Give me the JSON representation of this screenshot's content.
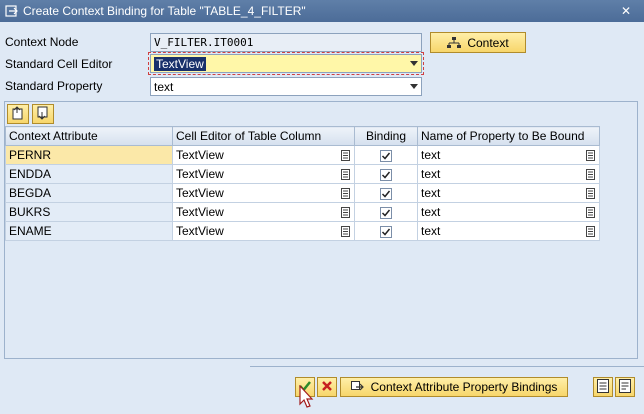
{
  "window": {
    "title": "Create Context Binding for Table \"TABLE_4_FILTER\"",
    "title_icon": "create-icon",
    "close_glyph": "✕"
  },
  "form": {
    "context_node_label": "Context Node",
    "context_node_value": "V_FILTER.IT0001",
    "context_button_label": "Context",
    "cell_editor_label": "Standard Cell Editor",
    "cell_editor_value": "TextView",
    "property_label": "Standard Property",
    "property_value": "text"
  },
  "table": {
    "toolbar_icons": [
      "insert-row-icon",
      "delete-row-icon"
    ],
    "columns": [
      "Context Attribute",
      "Cell Editor of Table Column",
      "Binding",
      "Name of Property to Be Bound"
    ],
    "rows": [
      {
        "attribute": "PERNR",
        "editor": "TextView",
        "binding": true,
        "property": "text"
      },
      {
        "attribute": "ENDDA",
        "editor": "TextView",
        "binding": true,
        "property": "text"
      },
      {
        "attribute": "BEGDA",
        "editor": "TextView",
        "binding": true,
        "property": "text"
      },
      {
        "attribute": "BUKRS",
        "editor": "TextView",
        "binding": true,
        "property": "text"
      },
      {
        "attribute": "ENAME",
        "editor": "TextView",
        "binding": true,
        "property": "text"
      }
    ]
  },
  "footer": {
    "bindings_button_label": "Context Attribute Property Bindings"
  },
  "colors": {
    "titlebar": "#4c6c98",
    "button": "#f7d66b",
    "accept": "#2a8a2a",
    "cancel": "#c62020"
  }
}
